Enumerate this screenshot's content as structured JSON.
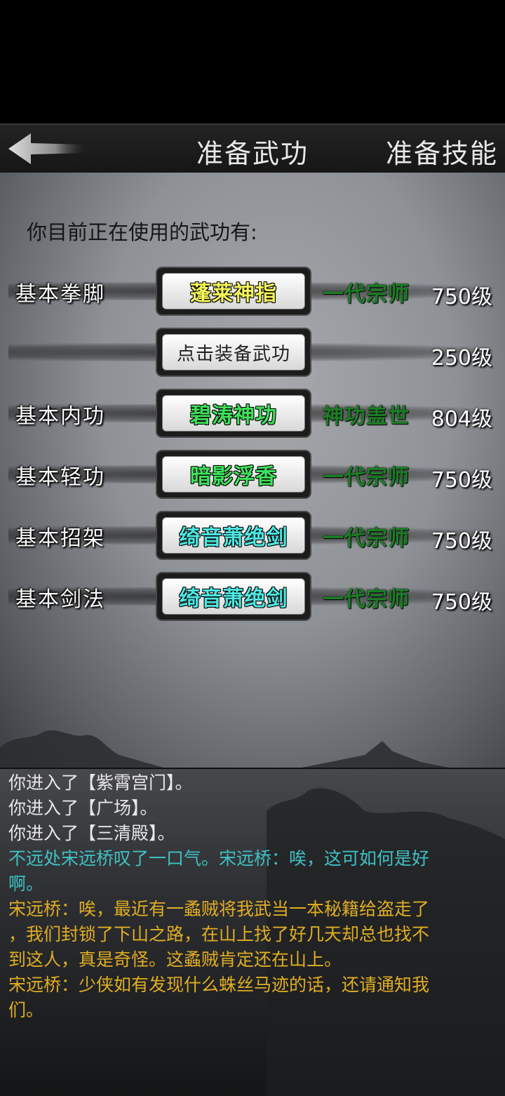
{
  "header": {
    "title": "准备武功",
    "right_tab": "准备技能"
  },
  "intro": "你目前正在使用的武功有:",
  "slots": [
    {
      "label": "基本拳脚",
      "skill": "蓬莱神指",
      "skill_color": "yellow",
      "rank": "一代宗师",
      "level": "750级"
    },
    {
      "label": "",
      "skill": "点击装备武功",
      "skill_color": "empty",
      "rank": "",
      "level": "250级"
    },
    {
      "label": "基本内功",
      "skill": "碧涛神功",
      "skill_color": "green",
      "rank": "神功盖世",
      "level": "804级"
    },
    {
      "label": "基本轻功",
      "skill": "暗影浮香",
      "skill_color": "green",
      "rank": "一代宗师",
      "level": "750级"
    },
    {
      "label": "基本招架",
      "skill": "绮音萧绝剑",
      "skill_color": "cyan",
      "rank": "一代宗师",
      "level": "750级"
    },
    {
      "label": "基本剑法",
      "skill": "绮音萧绝剑",
      "skill_color": "cyan",
      "rank": "一代宗师",
      "level": "750级"
    }
  ],
  "log": [
    {
      "color": "white",
      "lines": [
        "你进入了【紫霄宫门】。"
      ]
    },
    {
      "color": "white",
      "lines": [
        "你进入了【广场】。"
      ]
    },
    {
      "color": "white",
      "lines": [
        "你进入了【三清殿】。"
      ]
    },
    {
      "color": "cyan",
      "lines": [
        "不远处宋远桥叹了一口气。宋远桥：唉，这可如何是好",
        "啊。"
      ]
    },
    {
      "color": "gold",
      "lines": [
        "宋远桥：唉，最近有一蟊贼将我武当一本秘籍给盗走了",
        "，我们封锁了下山之路，在山上找了好几天却总也找不",
        "到这人，真是奇怪。这蟊贼肯定还在山上。"
      ]
    },
    {
      "color": "gold",
      "lines": [
        "宋远桥：少侠如有发现什么蛛丝马迹的话，还请通知我",
        "们。"
      ]
    }
  ]
}
